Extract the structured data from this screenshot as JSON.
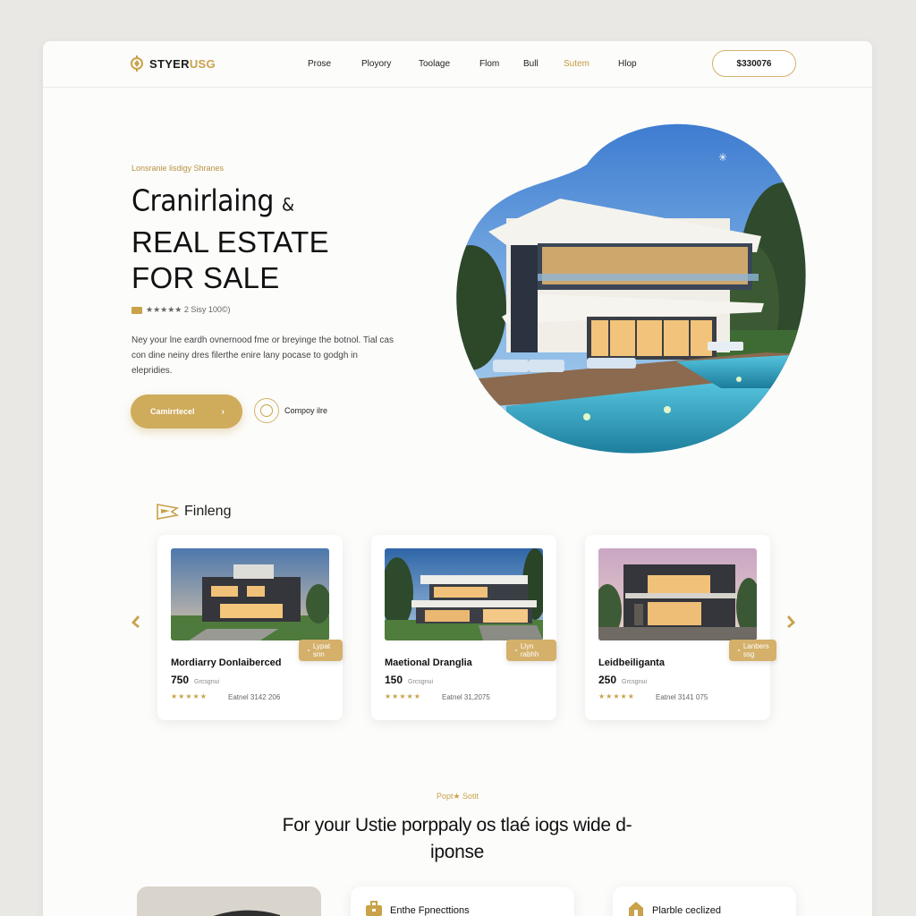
{
  "header": {
    "logo": {
      "brand_a": "STYER",
      "brand_b": "USG"
    },
    "nav": [
      "Prose",
      "Ployory",
      "Toolage",
      "Flom",
      "Bull",
      "Sutem",
      "Hlop"
    ],
    "active_nav_index": 5,
    "phone_button": "$330076"
  },
  "hero": {
    "eyebrow": "Lonsranie lisdigy Shranes",
    "title_line1": "Cranirlaing",
    "title_amp": "&",
    "title_line2": "REAL ESTATE FOR SALE",
    "rating_text": "★★★★★ 2 Sisy 100©)",
    "description": "Ney your lne eardh ovnernood fme or breyinge the botnol. Tial cas con dine neiny dres filerthe enire lany pocase to godgh in elepridies.",
    "primary_button": "Camirrtecel",
    "secondary_link": "Compoy ilre"
  },
  "featured": {
    "heading": "Finleng",
    "cards": [
      {
        "name": "Mordiarry Donlaiberced",
        "size": "750",
        "unit": "Grcsgnui",
        "stars": "★★★★★",
        "price": "Eatnel 3142 206",
        "badge": "Lypat snn"
      },
      {
        "name": "Maetional Dranglia",
        "size": "150",
        "unit": "Grcsgnui",
        "stars": "★★★★★",
        "price": "Eatnel 31,2075",
        "badge": "Llyn rabhh"
      },
      {
        "name": "Leidbeiliganta",
        "size": "250",
        "unit": "Grcsgnui",
        "stars": "★★★★★",
        "price": "Eatnel 3141 075",
        "badge": "Lanbers ssg"
      }
    ]
  },
  "section": {
    "eyebrow": "Popt★ Sotit",
    "title": "For your Ustie porppaly os tlaé iogs wide d-iponse",
    "cards": [
      {
        "label": "Enthe Fpnecttions",
        "icon": "briefcase-icon"
      },
      {
        "label": "Plarble ceclized",
        "icon": "home-icon"
      }
    ]
  },
  "colors": {
    "accent": "#c9a24a",
    "background": "#fcfcfb"
  }
}
